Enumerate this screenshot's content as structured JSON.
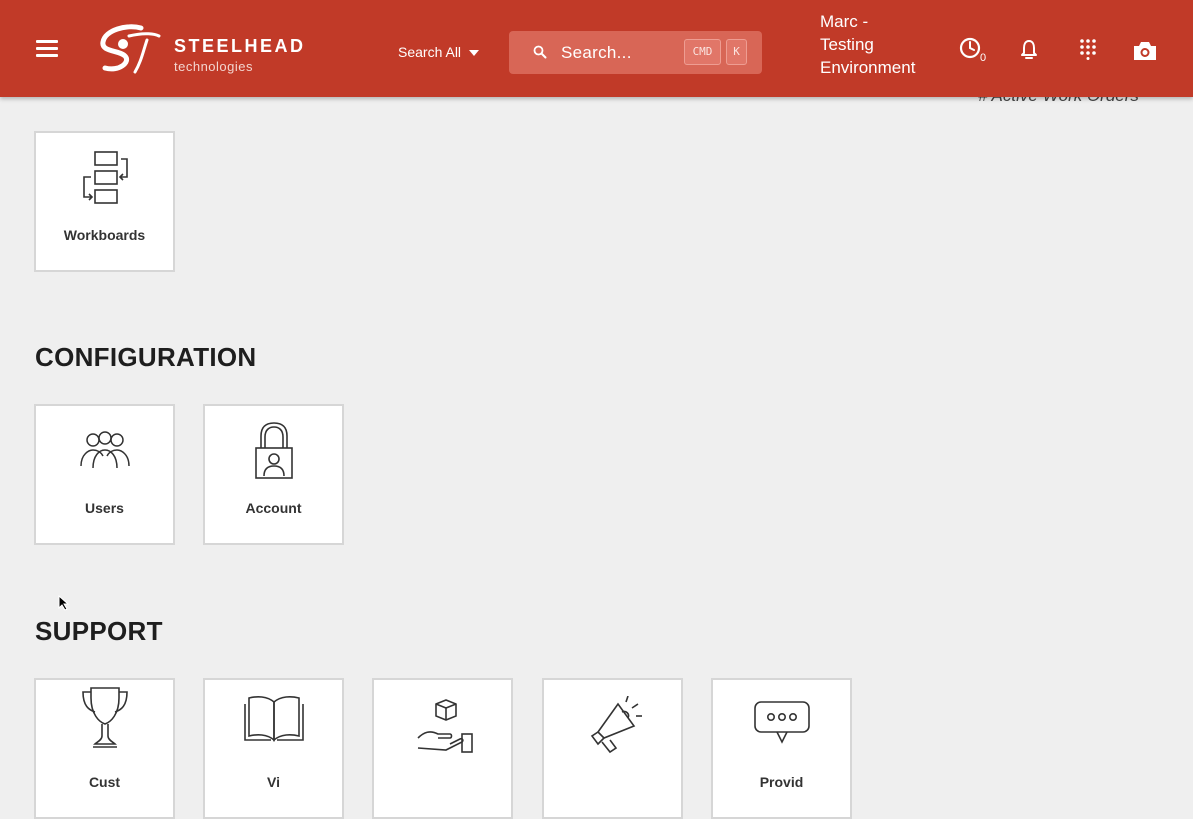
{
  "header": {
    "brand_name": "STEELHEAD",
    "brand_sub": "technologies",
    "search_scope": "Search All",
    "search_placeholder": "Search...",
    "kbd_cmd": "CMD",
    "kbd_k": "K",
    "environment_lines": [
      "Marc -",
      "Testing",
      "Environment"
    ],
    "timer_count": "0",
    "colors": {
      "bar": "#c13a28",
      "search_bg": "#d86656"
    }
  },
  "partially_hidden_text": "# Active Work Orders",
  "sections": [
    {
      "title": "",
      "tiles": [
        {
          "label": "Workboards",
          "icon": "workboards-icon"
        }
      ]
    },
    {
      "title": "CONFIGURATION",
      "tiles": [
        {
          "label": "Users",
          "icon": "users-icon"
        },
        {
          "label": "Account",
          "icon": "lock-user-icon"
        }
      ]
    },
    {
      "title": "SUPPORT",
      "tiles": [
        {
          "label": "Cust",
          "icon": "trophy-icon"
        },
        {
          "label": "Vi",
          "icon": "book-icon"
        },
        {
          "label": "",
          "icon": "hand-box-icon"
        },
        {
          "label": "",
          "icon": "megaphone-icon"
        },
        {
          "label": "Provid",
          "icon": "chat-bubble-icon"
        }
      ]
    }
  ]
}
